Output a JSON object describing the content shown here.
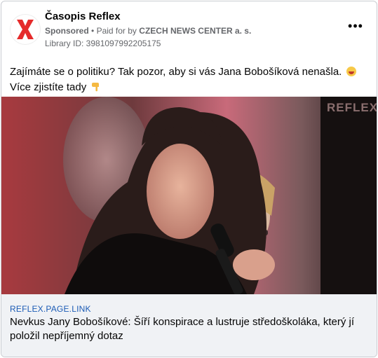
{
  "page": {
    "name": "Časopis Reflex",
    "sponsored": "Sponsored",
    "separator": "•",
    "paid_for_prefix": "Paid for by",
    "advertiser": "CZECH NEWS CENTER a. s.",
    "library_id": "Library ID: 3981097992205175",
    "more_label": "•••"
  },
  "post": {
    "text_main": "Zajímáte se o politiku? Tak pozor, aby si vás Jana Bobošíková nenašla.",
    "text_tail": "Více zjistíte tady"
  },
  "media": {
    "watermark": "REFLEX"
  },
  "link": {
    "domain": "REFLEX.PAGE.LINK",
    "headline": "Nevkus Jany Bobošíkové: Šíří konspirace a lustruje středoškoláka, který jí položil nepříjemný dotaz"
  },
  "colors": {
    "brand_red": "#e52b2b",
    "link_blue": "#1b5bb5",
    "text_gray": "#65676b"
  },
  "icons": [
    "reflex-x-logo-icon",
    "more-options-icon",
    "grinning-face-icon",
    "pointing-down-hand-icon"
  ]
}
